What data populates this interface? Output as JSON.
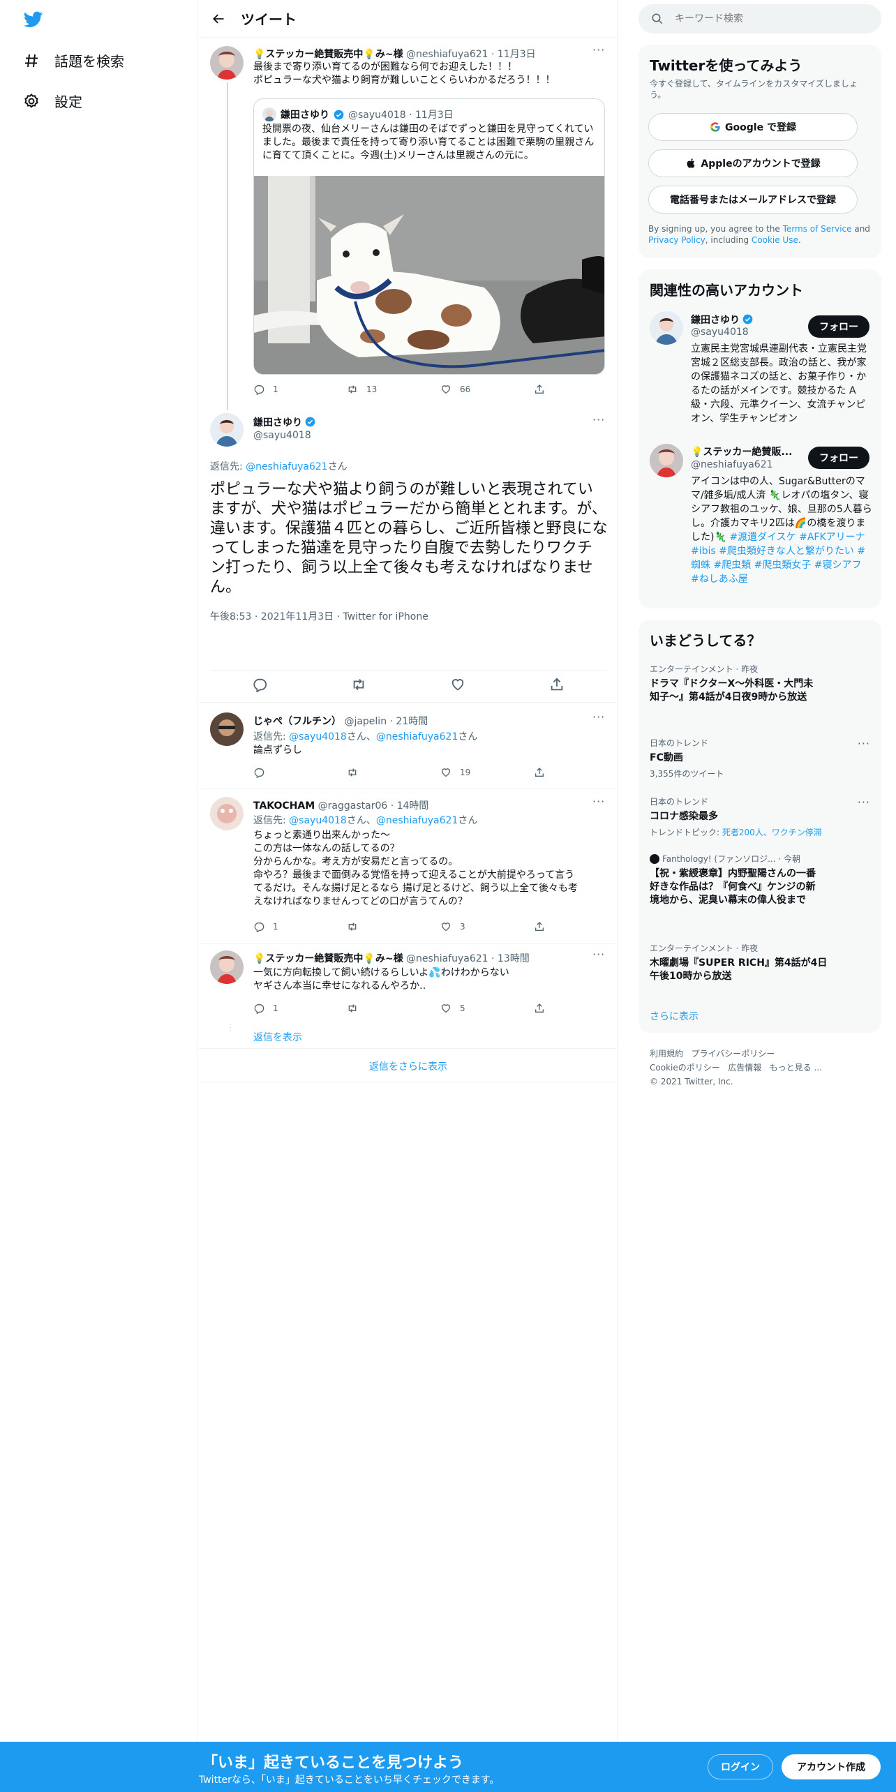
{
  "nav": {
    "explore": "話題を検索",
    "settings": "設定"
  },
  "header": {
    "title": "ツイート"
  },
  "tweet1": {
    "name": "💡ステッカー絶賛販売中💡み~様",
    "handle_time": "@neshiafuya621 · 11月3日",
    "line1": "最後まで寄り添い育てるのが困難なら何でお迎えした！！！",
    "line2": "ポピュラーな犬や猫より飼育が難しいことくらいわかるだろう！！！",
    "quote": {
      "name": "鎌田さゆり",
      "handle_time": "@sayu4018 · 11月3日",
      "text": "投開票の夜、仙台メリーさんは鎌田のそばでずっと鎌田を見守ってくれていました。最後まで責任を持って寄り添い育てることは困難で栗駒の里親さんに育てて頂くことに。今週(土)メリーさんは里親さんの元に。"
    },
    "stats": {
      "replies": "1",
      "retweets": "13",
      "likes": "66"
    }
  },
  "main_tweet": {
    "name": "鎌田さゆり",
    "handle": "@sayu4018",
    "reply_prefix": "返信先: ",
    "reply_to": "@neshiafuya621",
    "reply_suffix": "さん",
    "text": "ポピュラーな犬や猫より飼うのが難しいと表現されていますが、犬や猫はポピュラーだから簡単ととれます。が、違います。保護猫４匹との暮らし、ご近所皆様と野良になってしまった猫達を見守ったり自腹で去勢したりワクチン打ったり、飼う以上全て後々も考えなければなりません。",
    "meta": "午後8:53 · 2021年11月3日 · Twitter for iPhone"
  },
  "replies": [
    {
      "name": "じゃぺ（フルチン）",
      "handle_time": "@japelin · 21時間",
      "reply_prefix": "返信先: ",
      "mention1": "@sayu4018",
      "mid": "さん、",
      "mention2": "@neshiafuya621",
      "suffix": "さん",
      "text": "論点ずらし",
      "replies_count": "",
      "retweets": "",
      "likes": "19"
    },
    {
      "name": "TAKOCHAM",
      "handle_time": "@raggastar06 · 14時間",
      "reply_prefix": "返信先: ",
      "mention1": "@sayu4018",
      "mid": "さん、",
      "mention2": "@neshiafuya621",
      "suffix": "さん",
      "lines": [
        "ちょっと素通り出来んかった～",
        "この方は一体なんの話してるの？",
        "分からんかな。考え方が安易だと言ってるの。",
        "命やろ？最後まで面倒みる覚悟を持って迎えることが大前提やろって言う",
        "てるだけ。そんな揚げ足とるなら 揚げ足とるけど、飼う以上全て後々も考",
        "えなければなりませんってどの口が言うてんの？"
      ],
      "replies_count": "1",
      "retweets": "",
      "likes": "3"
    },
    {
      "name": "💡ステッカー絶賛販売中💡み~様",
      "handle_time": "@neshiafuya621 · 13時間",
      "lines": [
        "一気に方向転換して飼い続けるらしいよ💦わけわからない",
        "ヤギさん本当に幸せになれるんやろか‥"
      ],
      "replies_count": "1",
      "retweets": "",
      "likes": "5",
      "show_replies": "返信を表示"
    }
  ],
  "show_more": "返信をさらに表示",
  "right": {
    "search_placeholder": "キーワード検索",
    "signup": {
      "title": "Twitterを使ってみよう",
      "sub": "今すぐ登録して、タイムラインをカスタマイズしましょう。",
      "google": "Google で登録",
      "apple": "Appleのアカウントで登録",
      "phone": "電話番号またはメールアドレスで登録",
      "legal_1": "By signing up, you agree to the ",
      "terms": "Terms of Service",
      "legal_2": " and ",
      "privacy": "Privacy Policy",
      "legal_3": ", including ",
      "cookie": "Cookie Use",
      "legal_4": "."
    },
    "related": {
      "title": "関連性の高いアカウント",
      "follow": "フォロー",
      "a1": {
        "name": "鎌田さゆり",
        "handle": "@sayu4018",
        "bio": "立憲民主党宮城県連副代表・立憲民主党宮城２区総支部長。政治の話と、我が家の保護猫ネコズの話と、お菓子作り・かるたの話がメインです。競技かるた A級・六段、元準クイーン、女流チャンピオン、学生チャンピオン"
      },
      "a2": {
        "name": "💡ステッカー絶賛販...",
        "handle": "@neshiafuya621",
        "bio_plain": "アイコンは中の人、Sugar&Butterのママ/雑多垢/成人済 🦎レオパの塩タン、寝シアフ教祖のユッケ、娘、旦那の5人暮らし。介護カマキリ2匹は🌈の橋を渡りました)🦎",
        "tags": "#渡遺ダイスケ #AFKアリーナ #ibis #爬虫類好きな人と繋がりたい #蜘蛛 #爬虫類 #爬虫類女子 #寝シアフ #ねしあふ屋"
      }
    },
    "trends": {
      "title": "いまどうしてる？",
      "items": [
        {
          "meta": "エンターテインメント · 昨夜",
          "name": "ドラマ『ドクターX～外科医・大門未知子～』第4話が4日夜9時から放送",
          "sub": ""
        },
        {
          "meta": "日本のトレンド",
          "name": "FC動画",
          "sub": "3,355件のツイート"
        },
        {
          "meta": "日本のトレンド",
          "name": "コロナ感染最多",
          "sub_prefix": "トレンドトピック: ",
          "sub_link": "死者200人、ワクチン停滞"
        },
        {
          "meta": "Fanthology! (ファンソロジ... · 今朝",
          "name": "【祝・紫綬褒章】内野聖陽さんの一番好きな作品は？『何食べ』ケンジの新境地から、泥臭い幕末の偉人役まで",
          "sub": ""
        },
        {
          "meta": "エンターテインメント · 昨夜",
          "name": "木曜劇場『SUPER RICH』第4話が4日午後10時から放送",
          "sub": ""
        }
      ],
      "show_more": "さらに表示"
    },
    "footer": {
      "l1a": "利用規約",
      "l1b": "プライバシーポリシー",
      "l2a": "Cookieのポリシー",
      "l2b": "広告情報",
      "l2c": "もっと見る ...",
      "copy": "© 2021 Twitter, Inc."
    }
  },
  "banner": {
    "headline": "「いま」起きていることを見つけよう",
    "sub": "Twitterなら、「いま」起きていることをいち早くチェックできます。",
    "login": "ログイン",
    "signup": "アカウント作成"
  },
  "colors": {
    "accent": "#1d9bf0",
    "text": "#0f1419",
    "muted": "#536471"
  }
}
